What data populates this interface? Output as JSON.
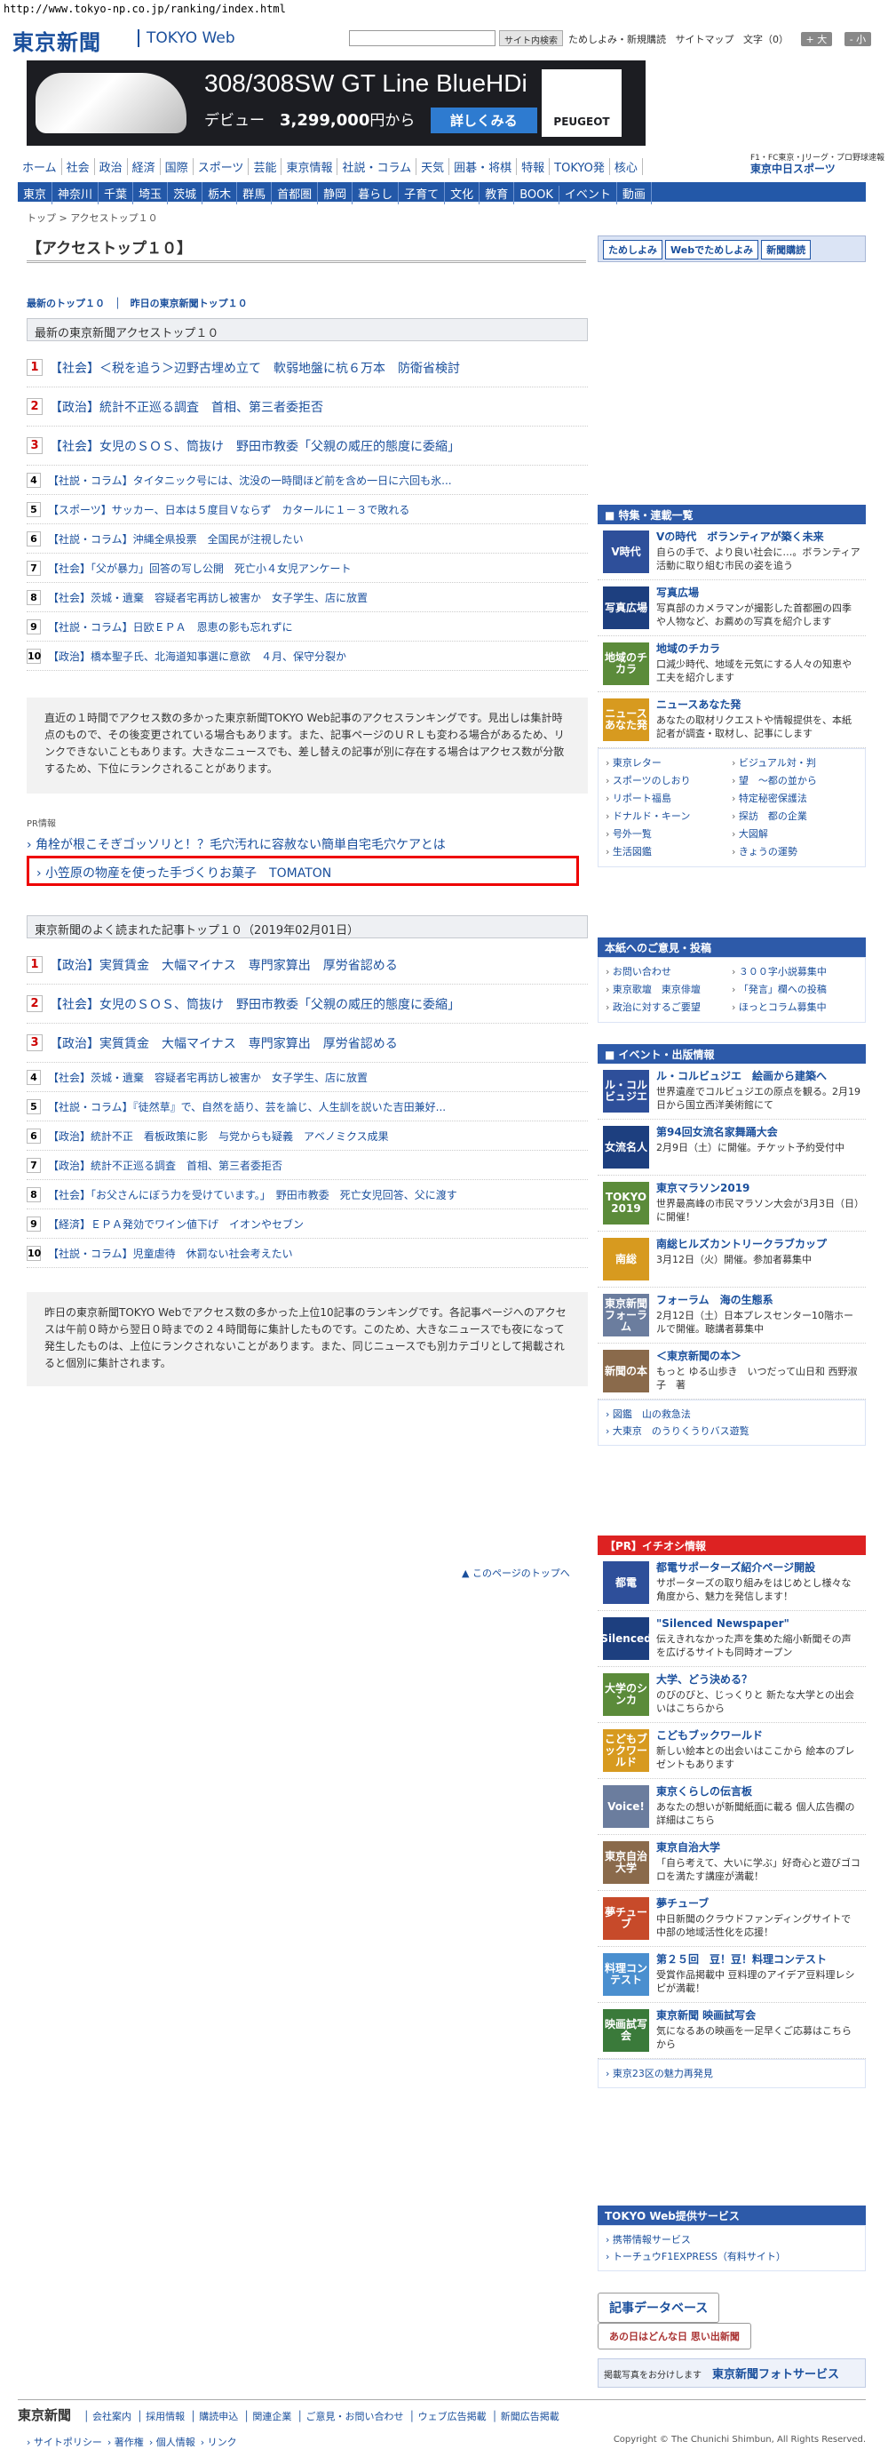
{
  "url": "http://www.tokyo-np.co.jp/ranking/index.html",
  "header": {
    "logo": "東京新聞",
    "logo_sub": "TOKYO Web",
    "search_btn": "サイト内検索",
    "links": [
      "ためしよみ・新規購読",
      "サイトマップ"
    ],
    "font_label": "文字（0）",
    "font_up": "+ 大",
    "font_down": "- 小"
  },
  "banner": {
    "title": "308/308SW GT Line BlueHDi",
    "subtitle": "デビュー",
    "price": "3,299,000",
    "price_suffix": "円から",
    "button": "詳しくみる",
    "brand": "PEUGEOT"
  },
  "nav1": [
    "ホーム",
    "社会",
    "政治",
    "経済",
    "国際",
    "スポーツ",
    "芸能",
    "東京情報",
    "社説・コラム",
    "天気",
    "囲碁・将棋",
    "特報",
    "TOKYO発",
    "核心"
  ],
  "f1": {
    "line1": "F1・FC東京・Jリーグ・プロ野球速報",
    "brand": "東京中日スポーツ"
  },
  "nav2": [
    "東京",
    "神奈川",
    "千葉",
    "埼玉",
    "茨城",
    "栃木",
    "群馬",
    "首都圏",
    "静岡",
    "暮らし",
    "子育て",
    "文化",
    "教育",
    "BOOK",
    "イベント",
    "動画"
  ],
  "breadcrumb": "トップ > アクセストップ１０",
  "page_title": "【アクセストップ１０】",
  "trial": [
    "ためしよみ",
    "Webでためしよみ",
    "新聞購読"
  ],
  "tabs": "最新のトップ１０　│　昨日の東京新聞トップ１０",
  "section1": {
    "title": "最新の東京新聞アクセストップ１０",
    "items": [
      {
        "rank": "1",
        "title": "【社会】＜税を追う＞辺野古埋め立て　軟弱地盤に杭６万本　防衛省検討"
      },
      {
        "rank": "2",
        "title": "【政治】統計不正巡る調査　首相、第三者委拒否"
      },
      {
        "rank": "3",
        "title": "【社会】女児のＳＯＳ、筒抜け　野田市教委「父親の威圧的態度に委縮」"
      },
      {
        "rank": "4",
        "title": "【社説・コラム】タイタニック号には、沈没の一時間ほど前を含め一日に六回も氷..."
      },
      {
        "rank": "5",
        "title": "【スポーツ】サッカー、日本は５度目Ｖならず　カタールに１－３で敗れる"
      },
      {
        "rank": "6",
        "title": "【社説・コラム】沖縄全県投票　全国民が注視したい"
      },
      {
        "rank": "7",
        "title": "【社会】「父が暴力」回答の写し公開　死亡小４女児アンケート"
      },
      {
        "rank": "8",
        "title": "【社会】茨城・遺棄　容疑者宅再訪し被害か　女子学生、店に放置"
      },
      {
        "rank": "9",
        "title": "【社説・コラム】日欧ＥＰＡ　恩恵の影も忘れずに"
      },
      {
        "rank": "10",
        "title": "【政治】橋本聖子氏、北海道知事選に意欲　４月、保守分裂か"
      }
    ]
  },
  "note1": "直近の１時間でアクセス数の多かった東京新聞TOKYO Web記事のアクセスランキングです。見出しは集計時点のもので、その後変更されている場合もあります。また、記事ページのＵＲＬも変わる場合があるため、リンクできないこともあります。大きなニュースでも、差し替えの記事が別に存在する場合はアクセス数が分散するため、下位にランクされることがあります。",
  "pr": {
    "label": "PR情報",
    "link1": "角栓が根こそぎゴッソリと！？毛穴汚れに容赦ない簡単自宅毛穴ケアとは",
    "link2": "小笠原の物産を使った手づくりお菓子　TOMATON"
  },
  "section2": {
    "title": "東京新聞のよく読まれた記事トップ１０（2019年02月01日）",
    "items": [
      {
        "rank": "1",
        "title": "【政治】実質賃金　大幅マイナス　専門家算出　厚労省認める"
      },
      {
        "rank": "2",
        "title": "【社会】女児のＳＯＳ、筒抜け　野田市教委「父親の威圧的態度に委縮」"
      },
      {
        "rank": "3",
        "title": "【政治】実質賃金　大幅マイナス　専門家算出　厚労省認める"
      },
      {
        "rank": "4",
        "title": "【社会】茨城・遺棄　容疑者宅再訪し被害か　女子学生、店に放置"
      },
      {
        "rank": "5",
        "title": "【社説・コラム】『徒然草』で、自然を語り、芸を論じ、人生訓を説いた吉田兼好..."
      },
      {
        "rank": "6",
        "title": "【政治】統計不正　看板政策に影　与党からも疑義　アベノミクス成果"
      },
      {
        "rank": "7",
        "title": "【政治】統計不正巡る調査　首相、第三者委拒否"
      },
      {
        "rank": "8",
        "title": "【社会】「お父さんにぼう力を受けています。」　野田市教委　死亡女児回答、父に渡す"
      },
      {
        "rank": "9",
        "title": "【経済】ＥＰＡ発効でワイン値下げ　イオンやセブン"
      },
      {
        "rank": "10",
        "title": "【社説・コラム】児童虐待　休罰ない社会考えたい"
      }
    ]
  },
  "note2": "昨日の東京新聞TOKYO Webでアクセス数の多かった上位10記事のランキングです。各記事ページへのアクセスは午前０時から翌日０時までの２４時間毎に集計したものです。このため、大きなニュースでも夜になって発生したものは、上位にランクされないことがあります。また、同じニュースでも別カテゴリとして掲載されると個別に集計されます。",
  "totop": "▲ このページのトップへ",
  "side1": {
    "title": "特集・連載一覧",
    "items": [
      {
        "thumb": "V時代",
        "title": "Vの時代　ボランティアが築く未来",
        "text": "自らの手で、より良い社会に…。ボランティア活動に取り組む市民の姿を追う"
      },
      {
        "thumb": "写真広場",
        "title": "写真広場",
        "text": "写真部のカメラマンが撮影した首都圏の四季や人物など、お薦めの写真を紹介します"
      },
      {
        "thumb": "地域のチカラ",
        "title": "地域のチカラ",
        "text": "口減少時代、地域を元気にする人々の知恵や工夫を紹介します"
      },
      {
        "thumb": "ニュースあなた発",
        "title": "ニュースあなた発",
        "text": "あなたの取材リクエストや情報提供を、本紙記者が調査・取材し、記事にします"
      }
    ],
    "links": [
      "東京レター",
      "ビジュアル対・判",
      "スポーツのしおり",
      "望　～都の並から",
      "リポート福島",
      "特定秘密保護法",
      "ドナルド・キーン",
      "探訪　都の企業",
      "号外一覧",
      "大図解",
      "生活図鑑",
      "きょうの運勢"
    ]
  },
  "side2": {
    "title": "本紙へのご意見・投稿",
    "links": [
      "お問い合わせ",
      "３００字小説募集中",
      "東京歌壇　東京俳壇",
      "「発言」欄への投稿",
      "政治に対するご要望",
      "ほっとコラム募集中"
    ]
  },
  "side3": {
    "title": "イベント・出版情報",
    "items": [
      {
        "thumb": "ル・コルビュジエ",
        "title": "ル・コルビュジエ　絵画から建築へ",
        "text": "世界遺産でコルビュジエの原点を観る。2月19日から国立西洋美術館にて"
      },
      {
        "thumb": "女流名人",
        "title": "第94回女流名家舞踊大会",
        "text": "2月9日（土）に開催。チケット予約受付中"
      },
      {
        "thumb": "TOKYO 2019",
        "title": "東京マラソン2019",
        "text": "世界最高峰の市民マラソン大会が3月3日（日）に開催！"
      },
      {
        "thumb": "南総",
        "title": "南総ヒルズカントリークラブカップ",
        "text": "3月12日（火）開催。参加者募集中"
      },
      {
        "thumb": "東京新聞フォーラム",
        "title": "フォーラム　海の生態系",
        "text": "2月12日（土）日本プレスセンター10階ホールで開催。聴講者募集中"
      },
      {
        "thumb": "新聞の本",
        "title": "＜東京新聞の本＞",
        "text": "もっと ゆる山歩き　いつだって山日和 西野淑子　著"
      }
    ],
    "links": [
      "図鑑　山の救急法",
      "大東京　のうりくうりバス遊覧"
    ]
  },
  "side4": {
    "title": "【PR】イチオシ情報",
    "items": [
      {
        "thumb": "都電",
        "title": "都電サポーターズ紹介ページ開設",
        "text": "サポーターズの取り組みをはじめとし様々な角度から、魅力を発信します！"
      },
      {
        "thumb": "Silenced",
        "title": "\"Silenced Newspaper\"",
        "text": "伝えきれなかった声を集めた縮小新聞その声を広げるサイトも同時オープン"
      },
      {
        "thumb": "大学のシンカ",
        "title": "大学、どう決める？",
        "text": "のびのびと、じっくりと 新たな大学との出会いはこちらから"
      },
      {
        "thumb": "こどもブックワールド",
        "title": "こどもブックワールド",
        "text": "新しい絵本との出会いはここから 絵本のプレゼントもあります"
      },
      {
        "thumb": "Voice!",
        "title": "東京くらしの伝言板",
        "text": "あなたの想いが新聞紙面に載る 個人広告欄の詳細はこちら"
      },
      {
        "thumb": "東京自治大学",
        "title": "東京自治大学",
        "text": "「自ら考えて、大いに学ぶ」好奇心と遊びゴコロを満たす講座が満載！"
      },
      {
        "thumb": "夢チューブ",
        "title": "夢チューブ",
        "text": "中日新聞のクラウドファンディングサイトで中部の地域活性化を応援！"
      },
      {
        "thumb": "料理コンテスト",
        "title": "第２５回　豆！豆！料理コンテスト",
        "text": "受賞作品掲載中 豆料理のアイデア豆料理レシピが満載！"
      },
      {
        "thumb": "映画試写会",
        "title": "東京新聞 映画試写会",
        "text": "気になるあの映画を一足早くご応募はこちらから"
      }
    ],
    "links": [
      "東京23区の魅力再発見"
    ]
  },
  "side5": {
    "title": "TOKYO Web提供サービス",
    "links": [
      "携帯情報サービス",
      "トーチュウF1EXPRESS（有料サイト）"
    ]
  },
  "side_btns": {
    "b1": "記事データベース",
    "b2": "あの日はどんな日 思い出新聞",
    "b3": "東京新聞フォトサービス",
    "b3pre": "掲載写真をお分けします"
  },
  "footer": {
    "logo": "東京新聞",
    "links": [
      "会社案内",
      "採用情報",
      "購読申込",
      "関連企業",
      "ご意見・お問い合わせ",
      "ウェブ広告掲載",
      "新聞広告掲載"
    ],
    "links2": [
      "サイトポリシー",
      "著作権",
      "個人情報",
      "リンク"
    ],
    "copyright": "Copyright © The Chunichi Shimbun, All Rights Reserved."
  },
  "colors": {
    "brand": "#1a4f9c",
    "nav": "#2358a8",
    "alert": "#e00"
  }
}
